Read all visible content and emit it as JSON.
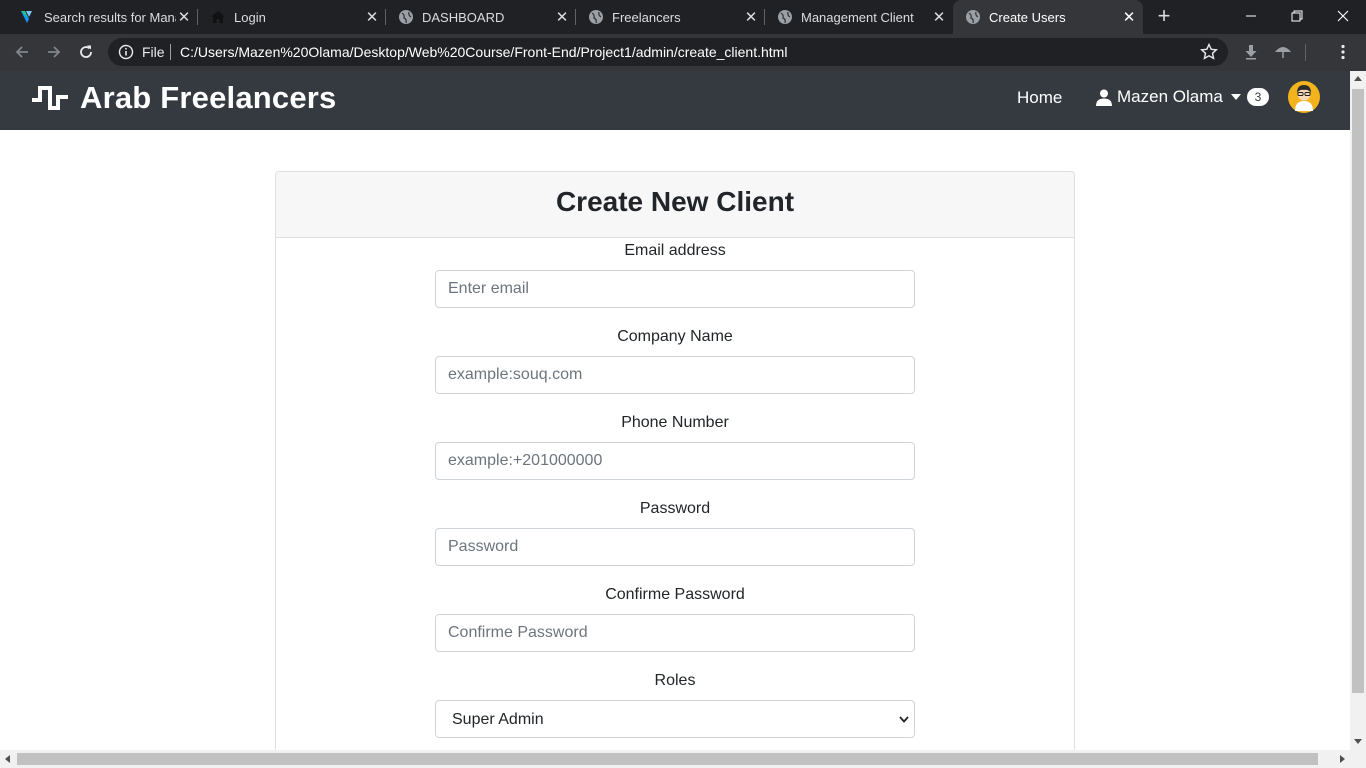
{
  "browser": {
    "tabs": [
      {
        "title": "Search results for Mana",
        "icon": "vuetify-icon"
      },
      {
        "title": "Login",
        "icon": "home-icon"
      },
      {
        "title": "DASHBOARD",
        "icon": "globe-icon"
      },
      {
        "title": "Freelancers",
        "icon": "globe-icon"
      },
      {
        "title": "Management Client",
        "icon": "globe-icon"
      },
      {
        "title": "Create Users",
        "icon": "globe-icon",
        "active": true
      }
    ],
    "new_tab": "+",
    "address": {
      "scheme_label": "File",
      "url": "C:/Users/Mazen%20Olama/Desktop/Web%20Course/Front-End/Project1/admin/create_client.html"
    }
  },
  "navbar": {
    "brand": "Arab Freelancers",
    "home": "Home",
    "user_name": "Mazen Olama",
    "notification_count": "3",
    "background": "#343a40"
  },
  "form": {
    "title": "Create New Client",
    "email": {
      "label": "Email address",
      "placeholder": "Enter email"
    },
    "company": {
      "label": "Company Name",
      "placeholder": "example:souq.com"
    },
    "phone": {
      "label": "Phone Number",
      "placeholder": "example:+201000000"
    },
    "password": {
      "label": "Password",
      "placeholder": "Password"
    },
    "confirm": {
      "label": "Confirme Password",
      "placeholder": "Confirme Password"
    },
    "roles": {
      "label": "Roles",
      "selected": "Super Admin"
    }
  }
}
